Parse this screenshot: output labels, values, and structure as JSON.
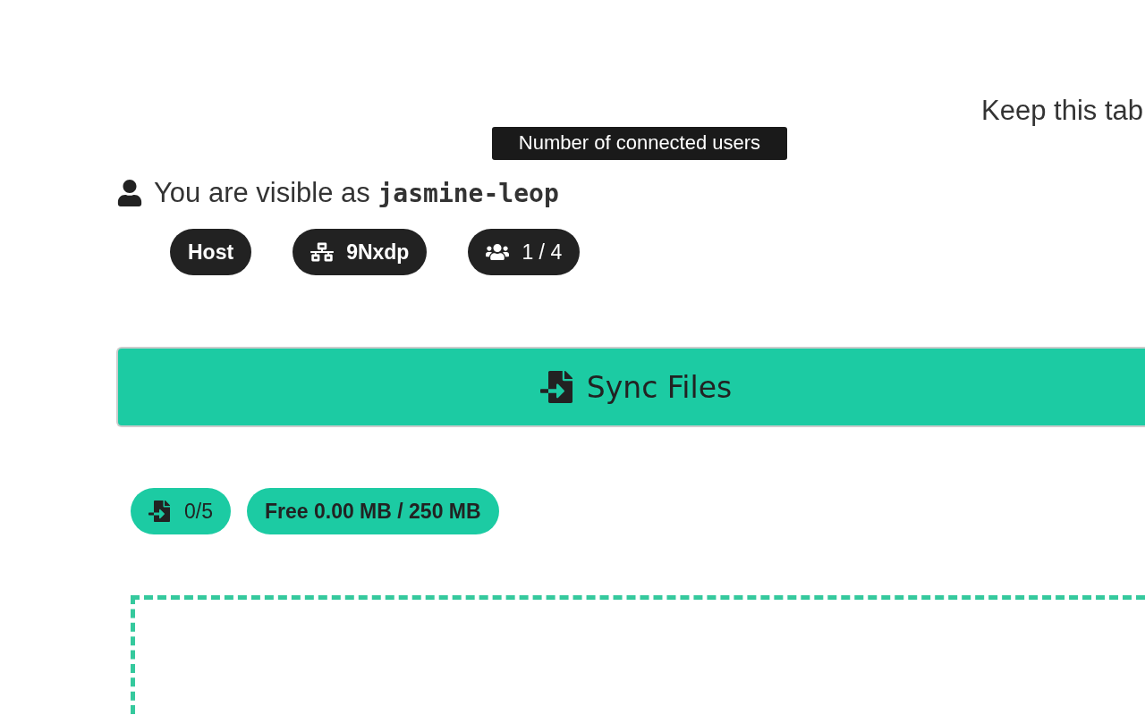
{
  "notice": "Keep this tab",
  "identity": {
    "prefix": "You are visible as",
    "name": "jasmine-leop"
  },
  "badges": [
    {
      "kind": "role",
      "label": "Host"
    },
    {
      "kind": "room",
      "label": "9Nxdp"
    },
    {
      "kind": "users",
      "label": "1 / 4"
    }
  ],
  "tooltip": "Number of connected users",
  "sync_button": "Sync Files",
  "stats": [
    {
      "kind": "files",
      "label": "0/5"
    },
    {
      "kind": "space",
      "label": "Free 0.00 MB / 250 MB"
    }
  ]
}
